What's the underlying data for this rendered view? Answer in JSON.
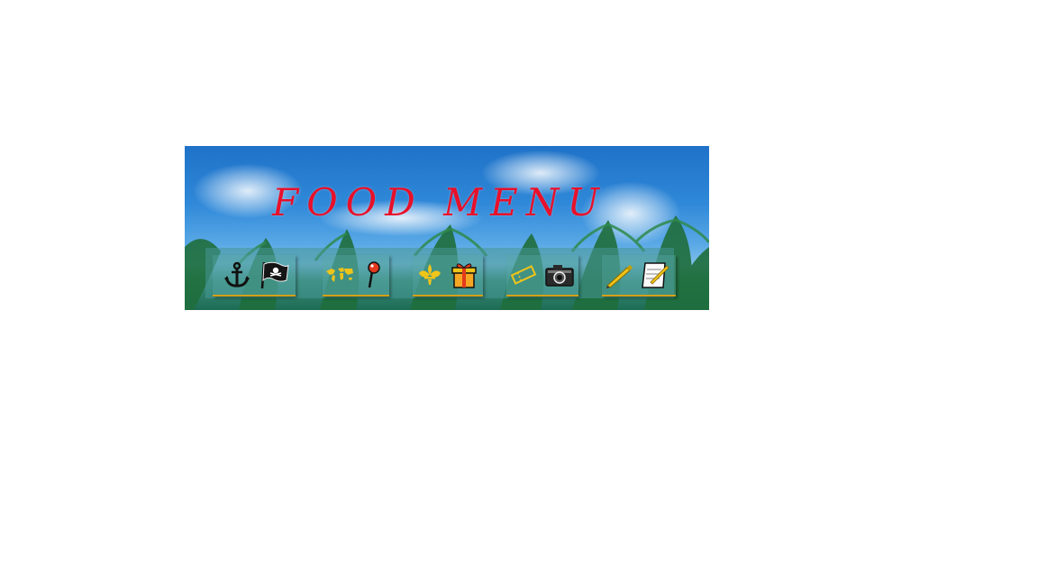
{
  "banner": {
    "title": "FOOD MENU"
  },
  "colors": {
    "title": "#e8102a",
    "nav_underline": "#d4a017",
    "icon_gold": "#f0c419",
    "icon_dark": "#1a1a1a"
  },
  "nav": {
    "groups": [
      {
        "icons": [
          "anchor-icon",
          "pirate-flag-icon"
        ]
      },
      {
        "icons": [
          "world-map-icon",
          "map-pin-icon"
        ]
      },
      {
        "icons": [
          "fleur-de-lis-icon",
          "gift-icon"
        ]
      },
      {
        "icons": [
          "ticket-icon",
          "camera-icon"
        ]
      },
      {
        "icons": [
          "pen-icon",
          "notepad-icon"
        ]
      }
    ]
  }
}
